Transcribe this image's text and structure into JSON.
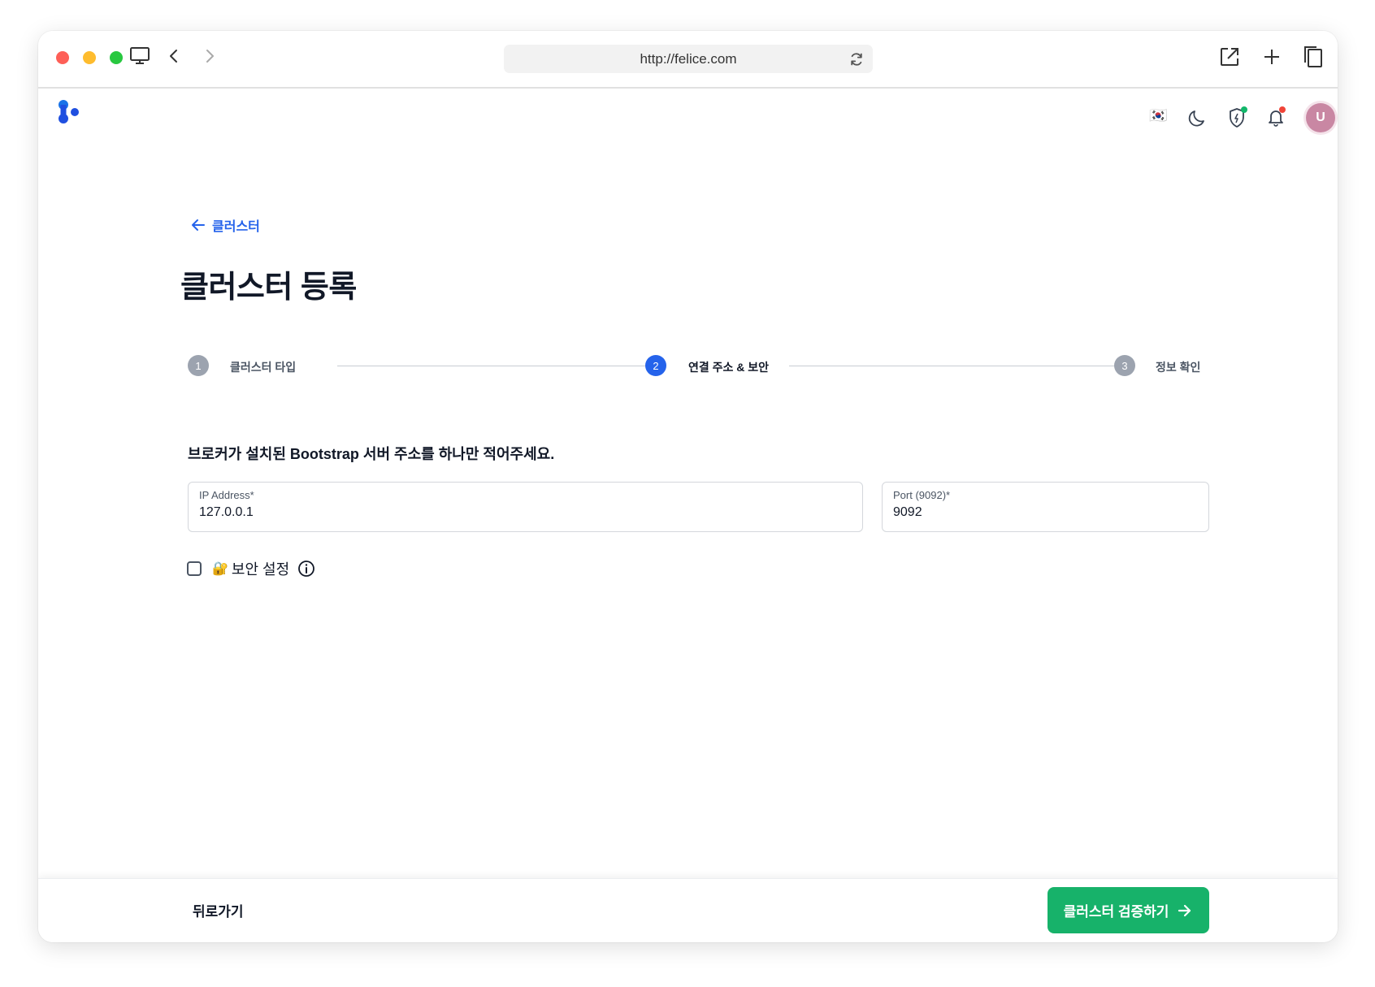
{
  "browser": {
    "url": "http://felice.com"
  },
  "header": {
    "language_flag": "🇰🇷",
    "avatar_initial": "U",
    "shield_badge_color": "#12b76a",
    "notification_badge_color": "#f04438"
  },
  "breadcrumb": {
    "back_label": "클러스터"
  },
  "page": {
    "title": "클러스터 등록"
  },
  "stepper": {
    "steps": [
      {
        "number": "1",
        "label": "클러스터 타입",
        "state": "done"
      },
      {
        "number": "2",
        "label": "연결 주소 & 보안",
        "state": "active"
      },
      {
        "number": "3",
        "label": "정보 확인",
        "state": "pending"
      }
    ]
  },
  "form": {
    "instruction": "브로커가 설치된 Bootstrap 서버 주소를 하나만 적어주세요.",
    "ip": {
      "label": "IP Address*",
      "value": "127.0.0.1"
    },
    "port": {
      "label": "Port (9092)*",
      "value": "9092"
    },
    "security": {
      "emoji": "🔐",
      "label": "보안 설정",
      "checked": false
    }
  },
  "footer": {
    "back_label": "뒤로가기",
    "verify_label": "클러스터 검증하기"
  },
  "colors": {
    "primary_blue": "#2563eb",
    "success_green": "#17b26a",
    "step_inactive": "#9ca3af"
  }
}
